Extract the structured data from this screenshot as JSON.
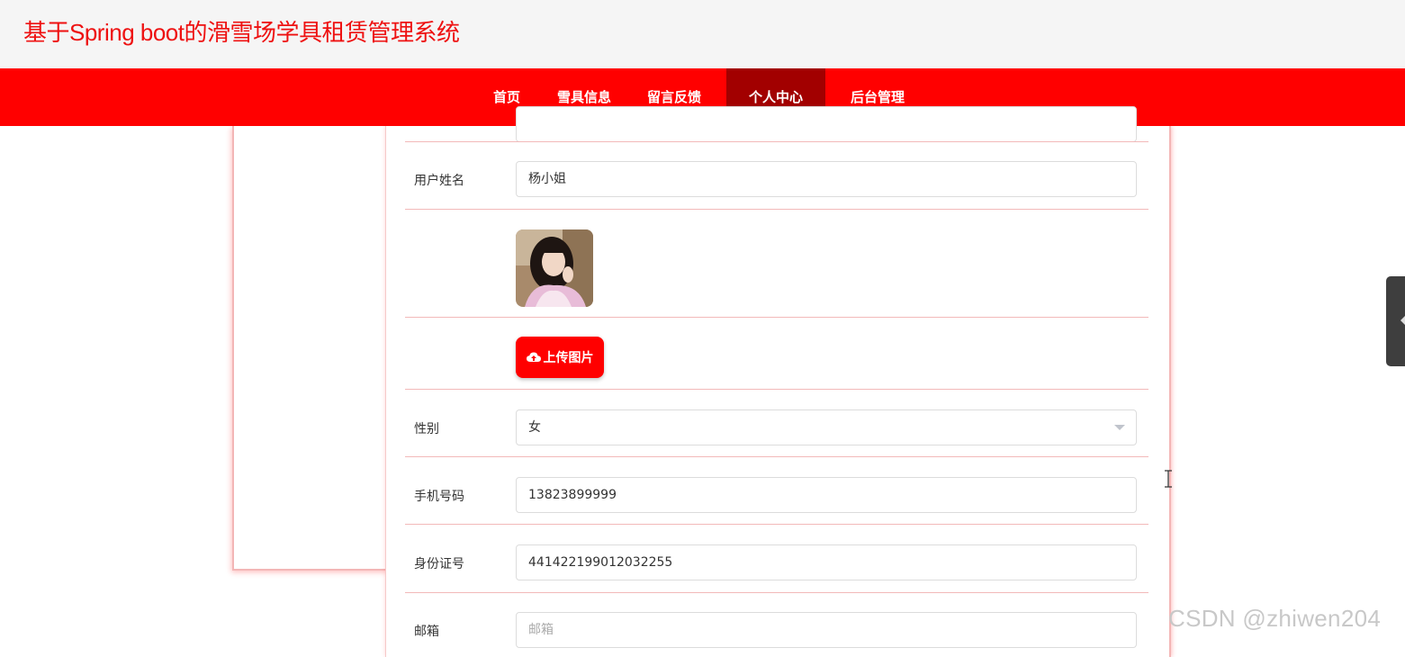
{
  "header": {
    "site_title": "基于Spring boot的滑雪场学具租赁管理系统"
  },
  "nav": {
    "items": [
      {
        "label": "首页"
      },
      {
        "label": "雪具信息"
      },
      {
        "label": "留言反馈"
      },
      {
        "label": "个人中心",
        "active": true
      },
      {
        "label": "后台管理"
      }
    ]
  },
  "form": {
    "name_label": "用户姓名",
    "name_value": "杨小姐",
    "upload_label": "上传图片",
    "gender_label": "性别",
    "gender_value": "女",
    "phone_label": "手机号码",
    "phone_value": "13823899999",
    "idcard_label": "身份证号",
    "idcard_value": "441422199012032255",
    "email_label": "邮箱",
    "email_placeholder": "邮箱"
  },
  "watermark": "CSDN @zhiwen204",
  "colors": {
    "brand": "#ff0000",
    "active_nav": "#a20000"
  },
  "icons": {
    "upload": "cloud-upload-icon",
    "dropdown": "chevron-down-icon"
  }
}
